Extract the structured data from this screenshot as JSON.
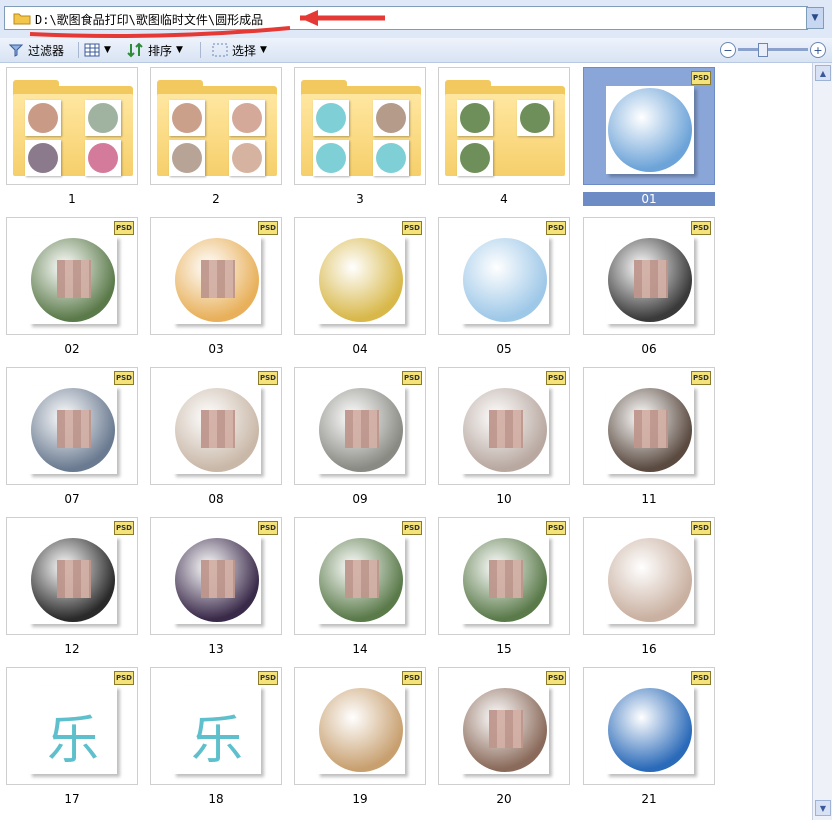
{
  "address": {
    "path": "D:\\歌图食品打印\\歌图临时文件\\圆形成品"
  },
  "toolbar": {
    "filter_label": "过滤器",
    "sort_label": "排序",
    "select_label": "选择"
  },
  "colors": {
    "selection": "#8aa6d8",
    "annotation": "#e53935",
    "toolbar_bg": "#dfe8f6"
  },
  "folders": [
    {
      "label": "1",
      "thumbs": [
        "#c99b87",
        "#a0b3a0",
        "#8a7a8c",
        "#d47a9a"
      ]
    },
    {
      "label": "2",
      "thumbs": [
        "#caa08a",
        "#d4a99a",
        "#b8a497",
        "#d6b3a0"
      ]
    },
    {
      "label": "3",
      "thumbs": [
        "#7fcfd6",
        "#b49b8a",
        "#7fcfd6",
        "#7fcfd6"
      ]
    },
    {
      "label": "4",
      "thumbs": [
        "#6f8f5a",
        "#6f8f5a",
        "#6f8f5a"
      ]
    }
  ],
  "items": [
    {
      "label": "01",
      "badge": "PSD",
      "color": "#6ca3d8",
      "selected": true
    },
    {
      "label": "02",
      "badge": "PSD",
      "color": "#5b7a4a"
    },
    {
      "label": "03",
      "badge": "PSD",
      "color": "#e8b05a"
    },
    {
      "label": "04",
      "badge": "PSD",
      "color": "#d8b84a"
    },
    {
      "label": "05",
      "badge": "PSD",
      "color": "#9ec8e8"
    },
    {
      "label": "06",
      "badge": "PSD",
      "color": "#3a3a3a"
    },
    {
      "label": "07",
      "badge": "PSD",
      "color": "#6a7a90"
    },
    {
      "label": "08",
      "badge": "PSD",
      "color": "#c9b8a8"
    },
    {
      "label": "09",
      "badge": "PSD",
      "color": "#8a8a84"
    },
    {
      "label": "10",
      "badge": "PSD",
      "color": "#b8a8a0"
    },
    {
      "label": "11",
      "badge": "PSD",
      "color": "#5a4a40"
    },
    {
      "label": "12",
      "badge": "PSD",
      "color": "#2a2a2a"
    },
    {
      "label": "13",
      "badge": "PSD",
      "color": "#3a2a4a"
    },
    {
      "label": "14",
      "badge": "PSD",
      "color": "#5a7a4a"
    },
    {
      "label": "15",
      "badge": "PSD",
      "color": "#5a7a4a"
    },
    {
      "label": "16",
      "badge": "PSD",
      "color": "#c9b0a0"
    },
    {
      "label": "17",
      "badge": "PSD",
      "color": "#7fcfd6",
      "text": "乐"
    },
    {
      "label": "18",
      "badge": "PSD",
      "color": "#7fcfd6",
      "text": "乐"
    },
    {
      "label": "19",
      "badge": "PSD",
      "color": "#c8a070"
    },
    {
      "label": "20",
      "badge": "PSD",
      "color": "#8a6a5a"
    },
    {
      "label": "21",
      "badge": "PSD",
      "color": "#2a6ab8"
    }
  ]
}
